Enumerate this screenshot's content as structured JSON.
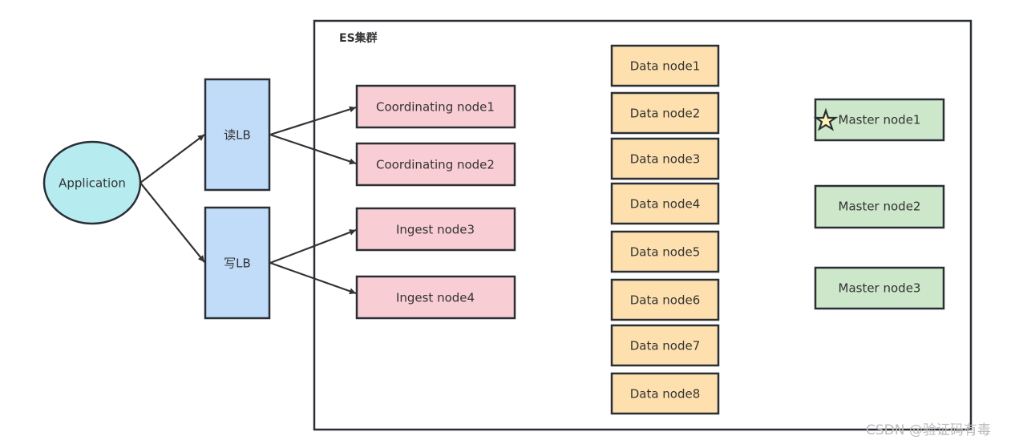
{
  "cluster": {
    "title": "ES集群"
  },
  "application": {
    "label": "Application",
    "color": "#b6ebf0"
  },
  "load_balancers": [
    {
      "label": "读LB",
      "color": "#c0dcf8"
    },
    {
      "label": "写LB",
      "color": "#c0dcf8"
    }
  ],
  "routing_nodes": [
    {
      "label": "Coordinating node1"
    },
    {
      "label": "Coordinating node2"
    },
    {
      "label": "Ingest node3"
    },
    {
      "label": "Ingest node4"
    }
  ],
  "data_nodes": [
    {
      "label": "Data node1"
    },
    {
      "label": "Data node2"
    },
    {
      "label": "Data node3"
    },
    {
      "label": "Data node4"
    },
    {
      "label": "Data node5"
    },
    {
      "label": "Data node6"
    },
    {
      "label": "Data node7"
    },
    {
      "label": "Data node8"
    }
  ],
  "master_nodes": [
    {
      "label": "Master node1",
      "icon": "star-icon"
    },
    {
      "label": "Master node2"
    },
    {
      "label": "Master node3"
    }
  ],
  "colors": {
    "routing": "#f8cdd4",
    "data": "#fde0ae",
    "master": "#cde7cb",
    "star": "#fff4b3",
    "stroke": "#2a2f36"
  },
  "edges": [
    {
      "from": "Application",
      "to": "读LB"
    },
    {
      "from": "Application",
      "to": "写LB"
    },
    {
      "from": "读LB",
      "to": "Coordinating node1"
    },
    {
      "from": "读LB",
      "to": "Coordinating node2"
    },
    {
      "from": "写LB",
      "to": "Ingest node3"
    },
    {
      "from": "写LB",
      "to": "Ingest node4"
    }
  ],
  "watermark": "CSDN @验证码有毒"
}
